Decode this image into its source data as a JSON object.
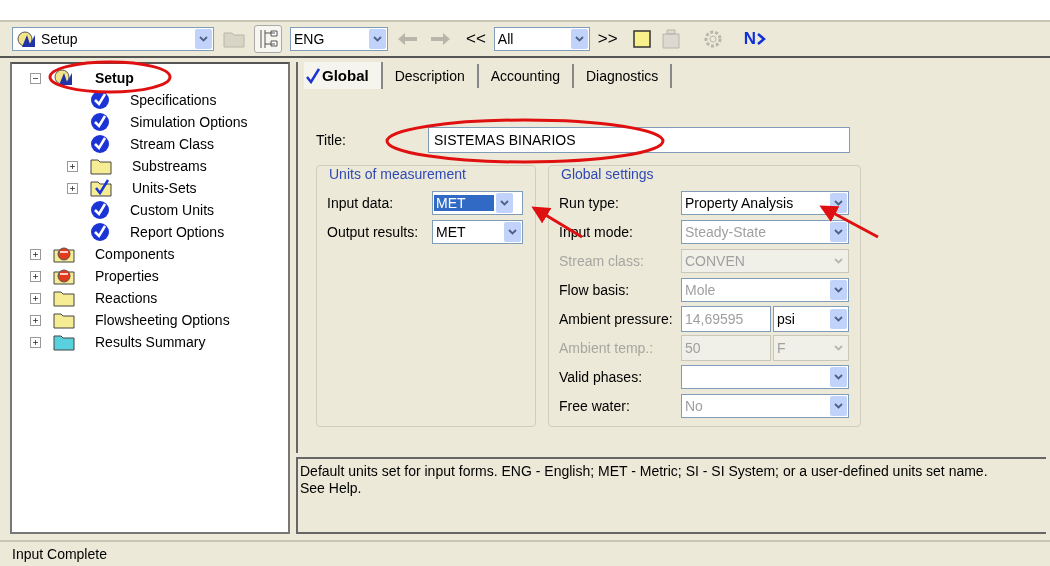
{
  "toolbar": {
    "form_selector": {
      "value": "Setup"
    },
    "units_selector": {
      "value": "ENG"
    },
    "previous_label": "<<",
    "filter_selector": {
      "value": "All"
    },
    "next_label": ">>",
    "next_form_label": "N"
  },
  "tree": [
    {
      "label": "Setup",
      "kind": "setup",
      "selected": true,
      "expanded": true,
      "children": [
        {
          "label": "Specifications",
          "kind": "check",
          "selected": false
        },
        {
          "label": "Simulation Options",
          "kind": "check",
          "selected": false
        },
        {
          "label": "Stream Class",
          "kind": "check",
          "selected": false
        },
        {
          "label": "Substreams",
          "kind": "folder",
          "selected": false,
          "expanded": false
        },
        {
          "label": "Units-Sets",
          "kind": "folder-check",
          "selected": false,
          "expanded": false
        },
        {
          "label": "Custom Units",
          "kind": "check",
          "selected": false
        },
        {
          "label": "Report Options",
          "kind": "check",
          "selected": false
        }
      ]
    },
    {
      "label": "Components",
      "kind": "flask",
      "selected": false,
      "expanded": false
    },
    {
      "label": "Properties",
      "kind": "flask",
      "selected": false,
      "expanded": false
    },
    {
      "label": "Reactions",
      "kind": "folder",
      "selected": false,
      "expanded": false
    },
    {
      "label": "Flowsheeting Options",
      "kind": "folder",
      "selected": false,
      "expanded": false
    },
    {
      "label": "Results Summary",
      "kind": "folder-results",
      "selected": false,
      "expanded": false
    }
  ],
  "tabs": [
    {
      "label": "Global",
      "selected": true,
      "complete": true
    },
    {
      "label": "Description",
      "selected": false,
      "complete": false
    },
    {
      "label": "Accounting",
      "selected": false,
      "complete": false
    },
    {
      "label": "Diagnostics",
      "selected": false,
      "complete": false
    }
  ],
  "form": {
    "title_label": "Title:",
    "title_value": "SISTEMAS BINARIOS",
    "units_group": {
      "heading": "Units of measurement",
      "fields": [
        {
          "label": "Input data:",
          "value": "MET",
          "selected": true
        },
        {
          "label": "Output results:",
          "value": "MET",
          "selected": false
        }
      ]
    },
    "global_group": {
      "heading": "Global settings",
      "fields": [
        {
          "kind": "combo",
          "label": "Run type:",
          "value": "Property Analysis",
          "disabled": false,
          "dimmed": false
        },
        {
          "kind": "combo",
          "label": "Input mode:",
          "value": "Steady-State",
          "disabled": false,
          "dimmed": true
        },
        {
          "kind": "combo",
          "label": "Stream class:",
          "value": "CONVEN",
          "disabled": true,
          "dimmed": true
        },
        {
          "kind": "combo",
          "label": "Flow basis:",
          "value": "Mole",
          "disabled": false,
          "dimmed": true
        },
        {
          "kind": "value-unit",
          "label": "Ambient pressure:",
          "value": "14,69595",
          "unit": "psi",
          "disabled": false,
          "dimmed": true
        },
        {
          "kind": "value-unit",
          "label": "Ambient temp.:",
          "value": "50",
          "unit": "F",
          "disabled": true,
          "dimmed": true
        },
        {
          "kind": "combo",
          "label": "Valid phases:",
          "disabled": false
        },
        {
          "kind": "combo",
          "label": "Free water:",
          "value": "No",
          "disabled": false,
          "dimmed": true
        }
      ]
    }
  },
  "help_text": "Default units set for input forms. ENG - English; MET - Metric; SI - SI System; or a user-defined units set name. See Help.",
  "status_bar": "Input Complete"
}
